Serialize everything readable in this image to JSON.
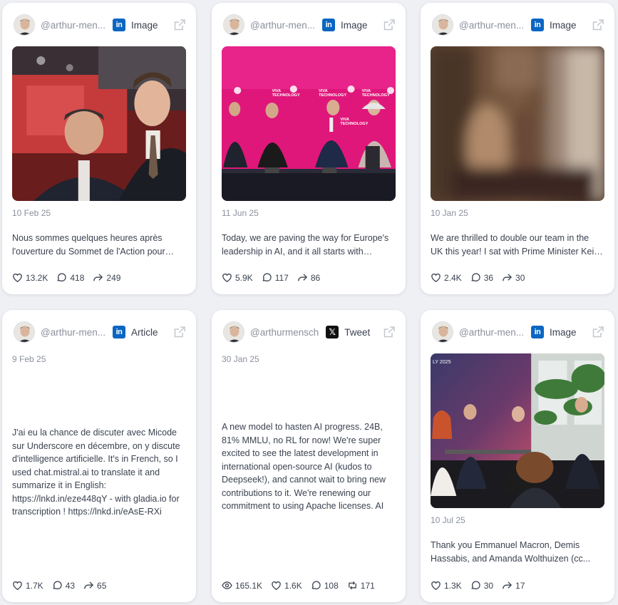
{
  "cards": [
    {
      "handle": "@arthur-men...",
      "platform": "linkedin",
      "platform_glyph": "in",
      "post_type": "Image",
      "date": "10 Feb 25",
      "text": "Nous sommes quelques heures après l'ouverture du Sommet de l'Action pour l'Intelligence Artificielle",
      "likes": "13.2K",
      "comments": "418",
      "shares": "249"
    },
    {
      "handle": "@arthur-men...",
      "platform": "linkedin",
      "platform_glyph": "in",
      "post_type": "Image",
      "date": "11 Jun 25",
      "text": "Today, we are paving the way for Europe's leadership in AI, and it all starts with infrastructure",
      "likes": "5.9K",
      "comments": "117",
      "shares": "86",
      "banner_text": [
        "VIVA",
        "TECHNOLOGY"
      ]
    },
    {
      "handle": "@arthur-men...",
      "platform": "linkedin",
      "platform_glyph": "in",
      "post_type": "Image",
      "date": "10 Jan 25",
      "text": "We are thrilled to double our team in the UK this year! I sat with Prime Minister Keir Starmer",
      "likes": "2.4K",
      "comments": "36",
      "shares": "30"
    },
    {
      "handle": "@arthur-men...",
      "platform": "linkedin",
      "platform_glyph": "in",
      "post_type": "Article",
      "date": "9 Feb 25",
      "text": "J'ai eu la chance de discuter avec Micode sur Underscore en décembre, on y discute d'intelligence artificielle. It's in French, so I used chat.mistral.ai to translate it and summarize it in English: https://lnkd.in/eze448qY - with gladia.io for transcription ! https://lnkd.in/eAsE-RXi",
      "likes": "1.7K",
      "comments": "43",
      "shares": "65"
    },
    {
      "handle": "@arthurmensch",
      "platform": "x",
      "platform_glyph": "𝕏",
      "post_type": "Tweet",
      "date": "30 Jan 25",
      "text": "A new model to hasten AI progress. 24B, 81% MMLU, no RL for now! We're super excited to see the latest development in international open-source AI (kudos to Deepseek!), and cannot wait to bring new contributions to it. We're renewing our commitment to using Apache licenses. AI",
      "views": "165.1K",
      "likes": "1.6K",
      "comments": "108",
      "retweets": "171"
    },
    {
      "handle": "@arthur-men...",
      "platform": "linkedin",
      "platform_glyph": "in",
      "post_type": "Image",
      "date": "10 Jul 25",
      "text": "Thank you Emmanuel Macron, Demis Hassabis, and Amanda Wolthuizen (cc...",
      "likes": "1.3K",
      "comments": "30",
      "shares": "17",
      "banner_text": "LY 2025"
    }
  ],
  "icons": {
    "like": "heart-icon",
    "comment": "comment-icon",
    "share": "share-icon",
    "views": "eye-icon",
    "retweet": "retweet-icon",
    "external": "external-link-icon"
  },
  "colors": {
    "linkedin": "#0a66c2",
    "x": "#111111",
    "vivatech": "#e0177a"
  }
}
